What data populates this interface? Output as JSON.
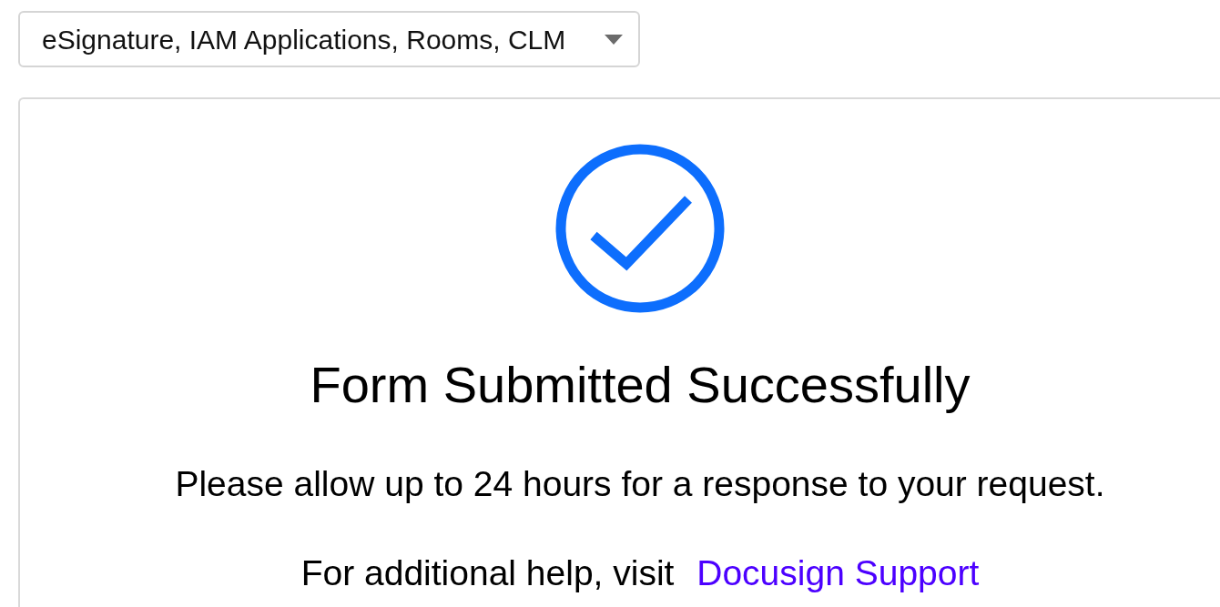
{
  "product_select": {
    "value": "eSignature, IAM Applications, Rooms, CLM"
  },
  "confirmation": {
    "title": "Form Submitted Successfully",
    "message": "Please allow up to 24 hours for a response to your request.",
    "help_text": "For additional help, visit",
    "help_link": "Docusign Support"
  }
}
